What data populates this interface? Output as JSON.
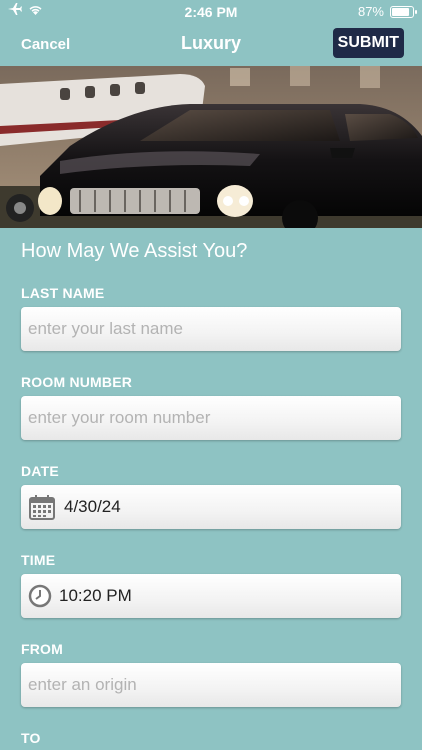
{
  "status": {
    "time": "2:46 PM",
    "battery_percent": "87%",
    "battery_level": 0.87
  },
  "nav": {
    "cancel_label": "Cancel",
    "title": "Luxury",
    "submit_label": "SUBMIT"
  },
  "form": {
    "heading": "How May We Assist You?",
    "last_name": {
      "label": "LAST NAME",
      "placeholder": "enter your last name"
    },
    "room_number": {
      "label": "ROOM NUMBER",
      "placeholder": "enter your room number"
    },
    "date": {
      "label": "DATE",
      "value": "4/30/24",
      "icon": "calendar-icon"
    },
    "time": {
      "label": "TIME",
      "value": "10:20 PM",
      "icon": "clock-icon"
    },
    "from": {
      "label": "FROM",
      "placeholder": "enter an origin"
    },
    "to": {
      "label": "TO"
    }
  }
}
